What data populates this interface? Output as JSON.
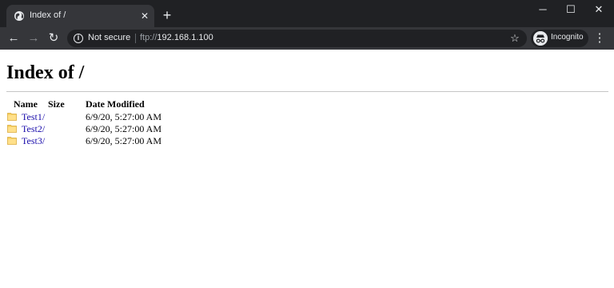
{
  "window": {
    "minimize_glyph": "─",
    "maximize_glyph": "☐",
    "close_glyph": "✕"
  },
  "tab": {
    "title": "Index of /",
    "close_glyph": "✕",
    "favicon": "globe-icon"
  },
  "new_tab_glyph": "+",
  "toolbar": {
    "back_glyph": "←",
    "forward_glyph": "→",
    "reload_glyph": "↻",
    "menu_glyph": "⋮"
  },
  "omnibox": {
    "security_label": "Not secure",
    "url_scheme": "ftp://",
    "url_host": "192.168.1.100",
    "star_glyph": "☆"
  },
  "incognito": {
    "label": "Incognito"
  },
  "page": {
    "heading": "Index of /",
    "columns": {
      "name": "Name",
      "size": "Size",
      "date": "Date Modified"
    },
    "entries": [
      {
        "name": "Test1/",
        "size": "",
        "date": "6/9/20, 5:27:00 AM"
      },
      {
        "name": "Test2/",
        "size": "",
        "date": "6/9/20, 5:27:00 AM"
      },
      {
        "name": "Test3/",
        "size": "",
        "date": "6/9/20, 5:27:00 AM"
      }
    ]
  },
  "colors": {
    "chrome_dark": "#202124",
    "chrome_tab": "#35363a",
    "link": "#1a0dab",
    "folder": "#f5cd5a"
  }
}
